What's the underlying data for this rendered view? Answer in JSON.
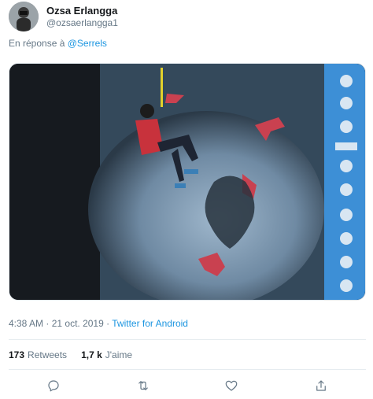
{
  "author": {
    "name": "Ozsa Erlangga",
    "handle": "@ozsaerlangga1"
  },
  "reply": {
    "prefix": "En réponse à",
    "mention": "@Serrels"
  },
  "media": {
    "icon": "photo-climber-icon"
  },
  "meta": {
    "time": "4:38 AM",
    "separator": "·",
    "date": "21 oct. 2019",
    "source": "Twitter for Android"
  },
  "stats": {
    "retweets_count": "173",
    "retweets_label": "Retweets",
    "likes_count": "1,7 k",
    "likes_label": "J'aime"
  },
  "actions": {
    "reply_icon": "reply-icon",
    "retweet_icon": "retweet-icon",
    "like_icon": "heart-icon",
    "share_icon": "share-icon"
  },
  "colors": {
    "link": "#1b95e0",
    "secondary": "#657786",
    "text": "#14171a"
  }
}
